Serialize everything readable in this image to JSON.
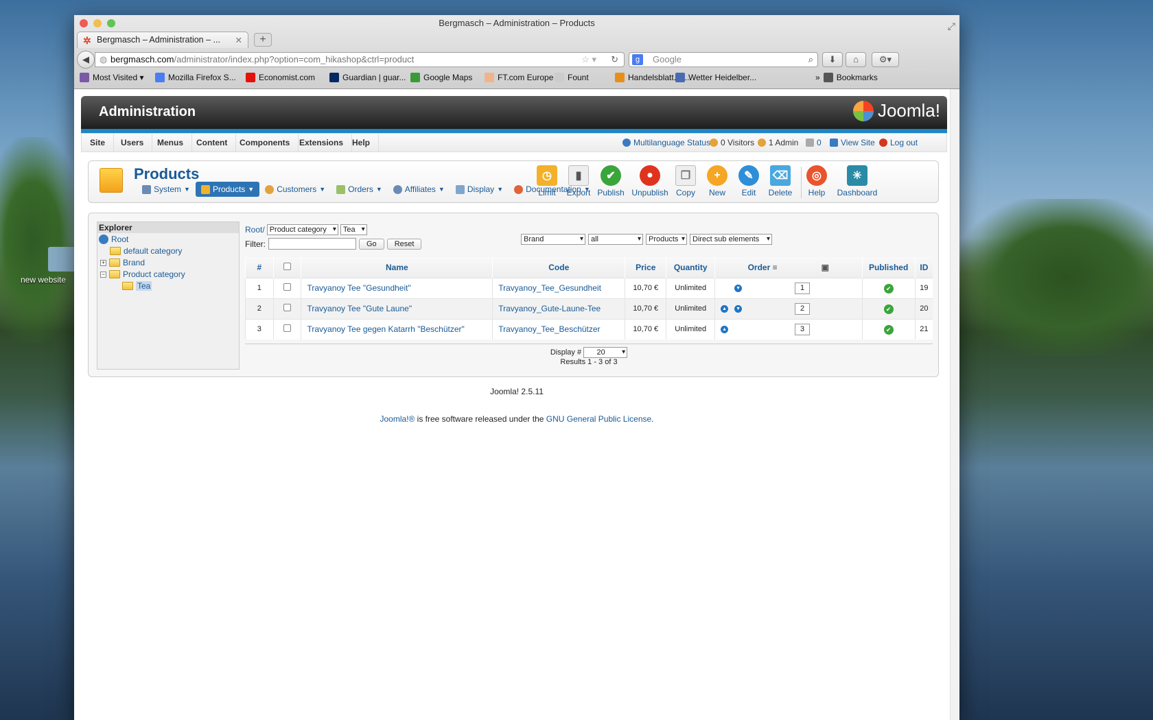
{
  "desktop": {
    "icon_label": "new website"
  },
  "window": {
    "title": "Bergmasch – Administration – Products"
  },
  "tab": {
    "title": "Bergmasch – Administration – ..."
  },
  "address": {
    "host": "bergmasch.com",
    "path": "/administrator/index.php?option=com_hikashop&ctrl=product"
  },
  "search": {
    "placeholder": "Google"
  },
  "bookmarks": [
    {
      "label": "Most Visited ▾",
      "color": "#7a5aa5"
    },
    {
      "label": "Mozilla Firefox S...",
      "color": "#4a7cf2"
    },
    {
      "label": "Economist.com",
      "color": "#e3120b"
    },
    {
      "label": "Guardian | guar...",
      "color": "#052962"
    },
    {
      "label": "Google Maps",
      "color": "#3a9a3a"
    },
    {
      "label": "FT.com Europe",
      "color": "#f1b48a"
    },
    {
      "label": "Fount",
      "color": "#cccccc"
    },
    {
      "label": "Handelsblatt.co...",
      "color": "#e88f1a"
    },
    {
      "label": "Wetter Heidelber...",
      "color": "#4a6ab2"
    }
  ],
  "bookmarks_more": "Bookmarks",
  "joomla": {
    "title": "Administration",
    "logo": "Joomla!"
  },
  "menu": [
    "Site",
    "Users",
    "Menus",
    "Content",
    "Components",
    "Extensions",
    "Help"
  ],
  "status": {
    "multilang": "Multilanguage Status",
    "visitors": "0 Visitors",
    "admin": "1 Admin",
    "messages": "0",
    "view_site": "View Site",
    "logout": "Log out"
  },
  "page_title": "Products",
  "submenu": [
    "System",
    "Products",
    "Customers",
    "Orders",
    "Affiliates",
    "Display",
    "Documentation"
  ],
  "toolbar": [
    "Limit",
    "Export",
    "Publish",
    "Unpublish",
    "Copy",
    "New",
    "Edit",
    "Delete",
    "Help",
    "Dashboard"
  ],
  "explorer": {
    "title": "Explorer",
    "root": "Root",
    "nodes": [
      "default category",
      "Brand",
      "Product category",
      "Tea"
    ]
  },
  "filters": {
    "root_link": "Root/",
    "category_select": "Product category",
    "sub_select": "Tea",
    "filter_label": "Filter:",
    "go": "Go",
    "reset": "Reset",
    "brand": "Brand",
    "all": "all",
    "products": "Products",
    "direct": "Direct sub elements"
  },
  "columns": {
    "num": "#",
    "name": "Name",
    "code": "Code",
    "price": "Price",
    "quantity": "Quantity",
    "order": "Order",
    "published": "Published",
    "id": "ID"
  },
  "rows": [
    {
      "num": "1",
      "name": "Travyanoy Tee \"Gesundheit\"",
      "code": "Travyanoy_Tee_Gesundheit",
      "price": "10,70 €",
      "qty": "Unlimited",
      "order": "1",
      "id": "19"
    },
    {
      "num": "2",
      "name": "Travyanoy Tee \"Gute Laune\"",
      "code": "Travyanoy_Gute-Laune-Tee",
      "price": "10,70 €",
      "qty": "Unlimited",
      "order": "2",
      "id": "20"
    },
    {
      "num": "3",
      "name": "Travyanoy Tee gegen Katarrh \"Beschützer\"",
      "code": "Travyanoy_Tee_Beschützer",
      "price": "10,70 €",
      "qty": "Unlimited",
      "order": "3",
      "id": "21"
    }
  ],
  "pagination": {
    "display_label": "Display #",
    "display_value": "20",
    "results": "Results 1 - 3 of 3"
  },
  "footer": {
    "version": "Joomla! 2.5.11",
    "link1": "Joomla!®",
    "text": " is free software released under the ",
    "link2": "GNU General Public License",
    "end": "."
  }
}
